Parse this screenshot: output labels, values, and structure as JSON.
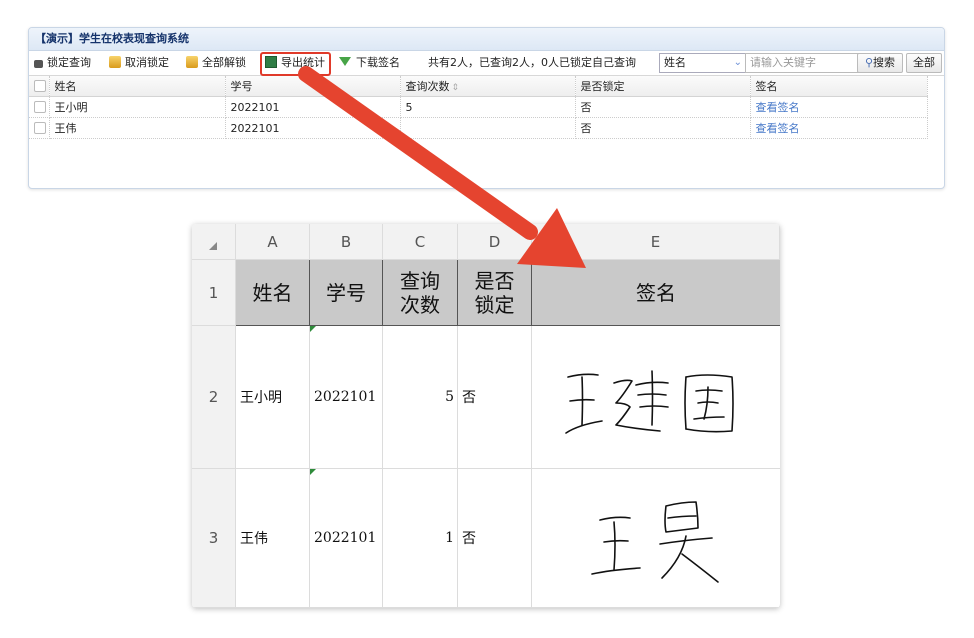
{
  "panel": {
    "title": "【演示】学生在校表现查询系统",
    "toolbar": {
      "lock": "锁定查询",
      "unlock": "取消锁定",
      "unlock_all": "全部解锁",
      "export": "导出统计",
      "download": "下载签名",
      "summary": "共有2人，已查询2人，0人已锁定自己查询",
      "field_select": "姓名",
      "keyword_placeholder": "请输入关键字",
      "search": "搜索",
      "all": "全部"
    },
    "table": {
      "headers": [
        "姓名",
        "学号",
        "查询次数",
        "是否锁定",
        "签名"
      ],
      "rows": [
        {
          "name": "王小明",
          "id": "2022101",
          "count": "5",
          "locked": "否",
          "sig": "查看签名"
        },
        {
          "name": "王伟",
          "id": "2022101",
          "count": "",
          "locked": "否",
          "sig": "查看签名"
        }
      ]
    }
  },
  "sheet": {
    "columns": [
      "A",
      "B",
      "C",
      "D",
      "E"
    ],
    "row_numbers": [
      "1",
      "2",
      "3"
    ],
    "headers": {
      "name": "姓名",
      "id": "学号",
      "count_l1": "查询",
      "count_l2": "次数",
      "locked_l1": "是否",
      "locked_l2": "锁定",
      "sig": "签名"
    },
    "rows": [
      {
        "name": "王小明",
        "id": "2022101",
        "count": "5",
        "locked": "否",
        "signature": "王建国"
      },
      {
        "name": "王伟",
        "id": "2022101",
        "count": "1",
        "locked": "否",
        "signature": "王昊"
      }
    ]
  },
  "colors": {
    "arrow": "#e5442f",
    "highlight_box": "#e03a2a",
    "title_text": "#15336b",
    "link": "#4577c8"
  }
}
